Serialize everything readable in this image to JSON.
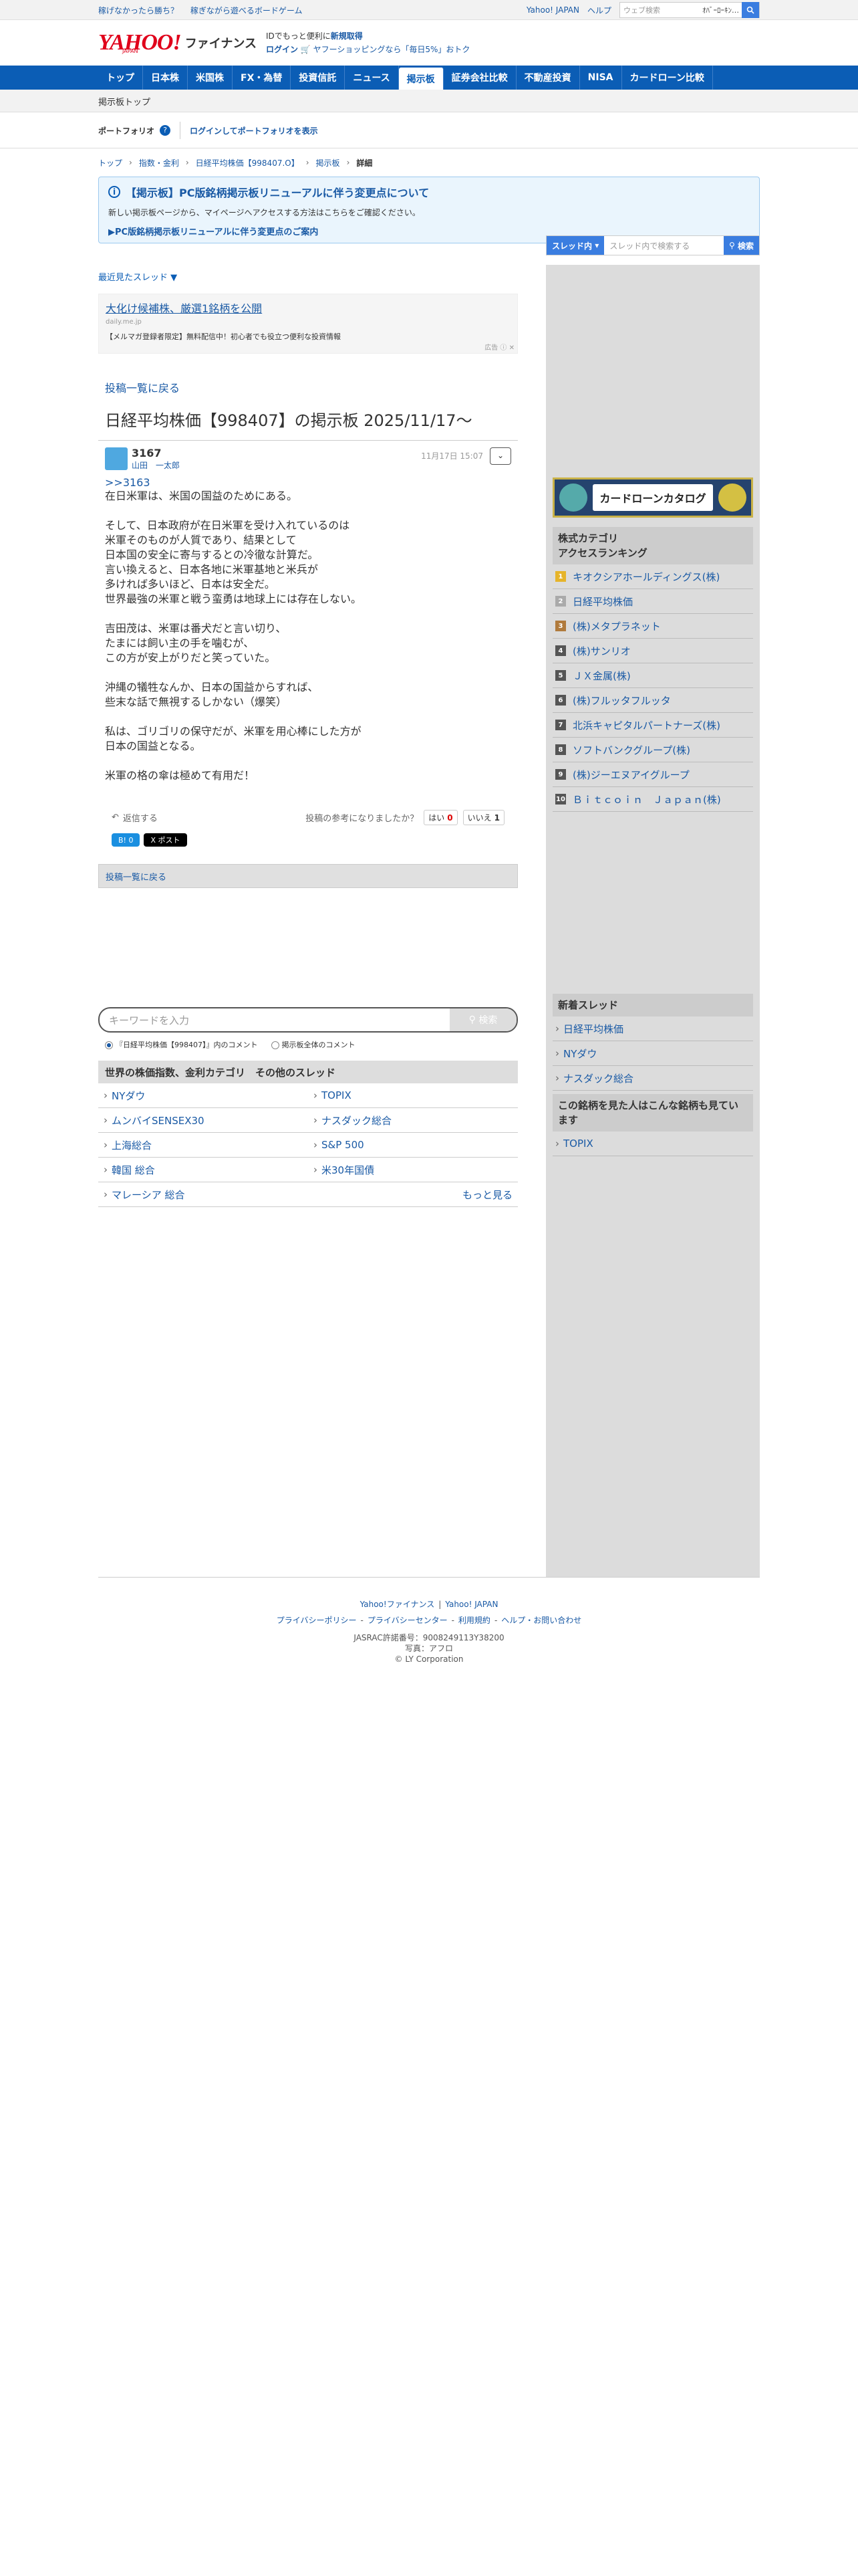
{
  "topbar": {
    "left_links": [
      "稼げなかったら勝ち？",
      "稼ぎながら遊べるボードゲーム"
    ],
    "right_links": [
      "Yahoo! JAPAN",
      "ヘルプ"
    ],
    "search_placeholder": "ウェブ検索",
    "search_value": "ｵﾊﾞｰﾛｰｷﾝ…",
    "search_icon": "search-icon"
  },
  "header": {
    "logo_text": "YAHOO!",
    "logo_sub": "JAPAN",
    "service_name": "ファイナンス",
    "info_line1_a": "IDでもっと便利に",
    "info_line1_b": "新規取得",
    "info_line2_a": "ログイン",
    "info_line2_b": "ヤフーショッピングなら「毎日5%」おトク"
  },
  "nav": {
    "items": [
      "トップ",
      "日本株",
      "米国株",
      "FX・為替",
      "投資信託",
      "ニュース",
      "掲示板",
      "証券会社比較",
      "不動産投資",
      "NISA",
      "カードローン比較"
    ],
    "active_index": 6
  },
  "subnav": {
    "label": "掲示板トップ"
  },
  "portfolio": {
    "label": "ポートフォリオ",
    "help": "?",
    "login_link": "ログインしてポートフォリオを表示"
  },
  "breadcrumb": [
    "トップ",
    "指数・金利",
    "日経平均株価【998407.O】",
    "掲示板",
    "詳細"
  ],
  "notice": {
    "title": "【掲示板】PC版銘柄掲示板リニューアルに伴う変更点について",
    "desc": "新しい掲示板ページから、マイページへアクセスする方法はこちらをご確認ください。",
    "link": "▶PC版銘柄掲示板リニューアルに伴う変更点のご案内"
  },
  "recent_threads": "最近見たスレッド ▼",
  "ad": {
    "headline": "大化け候補株、厳選1銘柄を公開",
    "url": "daily.me.jp",
    "text": "【メルマガ登録者限定】無料配信中！初心者でも役立つ便利な投資情報",
    "label": "広告"
  },
  "board": {
    "back_link": "投稿一覧に戻る",
    "title": "日経平均株価【998407】の掲示板 2025/11/17〜"
  },
  "post": {
    "number": "3167",
    "user": "山田　一太郎",
    "date": "11月17日 15:07",
    "reply_to": ">>3163",
    "lines": [
      "在日米軍は、米国の国益のためにある。",
      "",
      "そして、日本政府が在日米軍を受け入れているのは",
      "米軍そのものが人質であり、結果として",
      "日本国の安全に寄与するとの冷徹な計算だ。",
      "言い換えると、日本各地に米軍基地と米兵が",
      "多ければ多いほど、日本は安全だ。",
      "世界最強の米軍と戦う蛮勇は地球上には存在しない。",
      "",
      "吉田茂は、米軍は番犬だと言い切り、",
      "たまには飼い主の手を噛むが、",
      "この方が安上がりだと笑っていた。",
      "",
      "沖縄の犠牲なんか、日本の国益からすれば、",
      "些末な話で無視するしかない（爆笑）",
      "",
      "私は、ゴリゴリの保守だが、米軍を用心棒にした方が",
      "日本の国益となる。",
      "",
      "米軍の格の傘は極めて有用だ！"
    ],
    "reply_label": "返信する",
    "vote_question": "投稿の参考になりましたか？",
    "yes_label": "はい",
    "yes_count": "0",
    "no_label": "いいえ",
    "no_count": "1",
    "share_b": "B! 0",
    "share_x": "X ポスト"
  },
  "back_bar": "投稿一覧に戻る",
  "keyword": {
    "placeholder": "キーワードを入力",
    "button": "検索",
    "opt1": "『日経平均株価【998407】』内のコメント",
    "opt2": "掲示板全体のコメント"
  },
  "world": {
    "title": "世界の株価指数、金利カテゴリ　その他のスレッド",
    "items": [
      "NYダウ",
      "TOPIX",
      "ムンバイSENSEX30",
      "ナスダック総合",
      "上海総合",
      "S&P 500",
      "韓国 総合",
      "米30年国債"
    ],
    "last": "マレーシア 総合",
    "more": "もっと見る"
  },
  "rsearch": {
    "scope": "スレッド内",
    "placeholder": "スレッド内で検索する",
    "button": "検索"
  },
  "banner": {
    "text": "カードローンカタログ"
  },
  "ranking": {
    "title": "株式カテゴリ\nアクセスランキング",
    "items": [
      "キオクシアホールディングス(株)",
      "日経平均株価",
      "(株)メタプラネット",
      "(株)サンリオ",
      "ＪＸ金属(株)",
      "(株)フルッタフルッタ",
      "北浜キャピタルパートナーズ(株)",
      "ソフトバンクグループ(株)",
      "(株)ジーエヌアイグループ",
      "Ｂｉｔｃｏｉｎ　Ｊａｐａｎ(株)"
    ]
  },
  "new_threads": {
    "title": "新着スレッド",
    "items": [
      "日経平均株価",
      "NYダウ",
      "ナスダック総合"
    ]
  },
  "also_viewed": {
    "title": "この銘柄を見た人はこんな銘柄も見ています",
    "items": [
      "TOPIX"
    ]
  },
  "footer": {
    "row1": [
      "Yahoo!ファイナンス",
      "Yahoo! JAPAN"
    ],
    "row2": [
      "プライバシーポリシー",
      "プライバシーセンター",
      "利用規約",
      "ヘルプ・お問い合わせ"
    ],
    "jasrac": "JASRAC許諾番号：9008249113Y38200",
    "photo": "写真：アフロ",
    "copyright": "© LY Corporation"
  }
}
